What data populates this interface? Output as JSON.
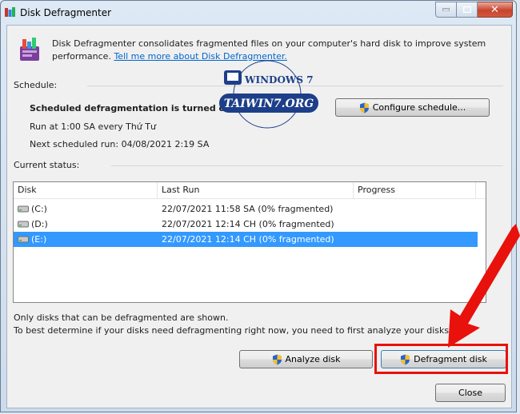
{
  "window": {
    "title": "Disk Defragmenter"
  },
  "intro": {
    "text": "Disk Defragmenter consolidates fragmented files on your computer's hard disk to improve system performance.",
    "link": "Tell me more about Disk Defragmenter."
  },
  "schedule": {
    "label": "Schedule:",
    "status": "Scheduled defragmentation is turned on",
    "run_at": "Run at 1:00 SA every Thứ Tư",
    "next_run": "Next scheduled run: 04/08/2021 2:19 SA",
    "configure_button": "Configure schedule..."
  },
  "current_status": {
    "label": "Current status:",
    "columns": [
      "Disk",
      "Last Run",
      "Progress"
    ],
    "rows": [
      {
        "disk": "(C:)",
        "last_run": "22/07/2021 11:58 SA (0% fragmented)",
        "progress": "",
        "selected": false
      },
      {
        "disk": "(D:)",
        "last_run": "22/07/2021 12:14 CH (0% fragmented)",
        "progress": "",
        "selected": false
      },
      {
        "disk": "(E:)",
        "last_run": "22/07/2021 12:14 CH (0% fragmented)",
        "progress": "",
        "selected": true
      }
    ]
  },
  "notes": {
    "line1": "Only disks that can be defragmented are shown.",
    "line2": "To best determine if your disks need defragmenting right now, you need to first analyze your disks."
  },
  "buttons": {
    "analyze": "Analyze disk",
    "defragment": "Defragment disk",
    "close": "Close"
  },
  "watermark": {
    "line1": "WINDOWS 7",
    "line2": "TAIWIN7.ORG"
  },
  "colors": {
    "selection": "#3399ff",
    "link": "#0066cc",
    "highlight_red": "#e8110c"
  }
}
